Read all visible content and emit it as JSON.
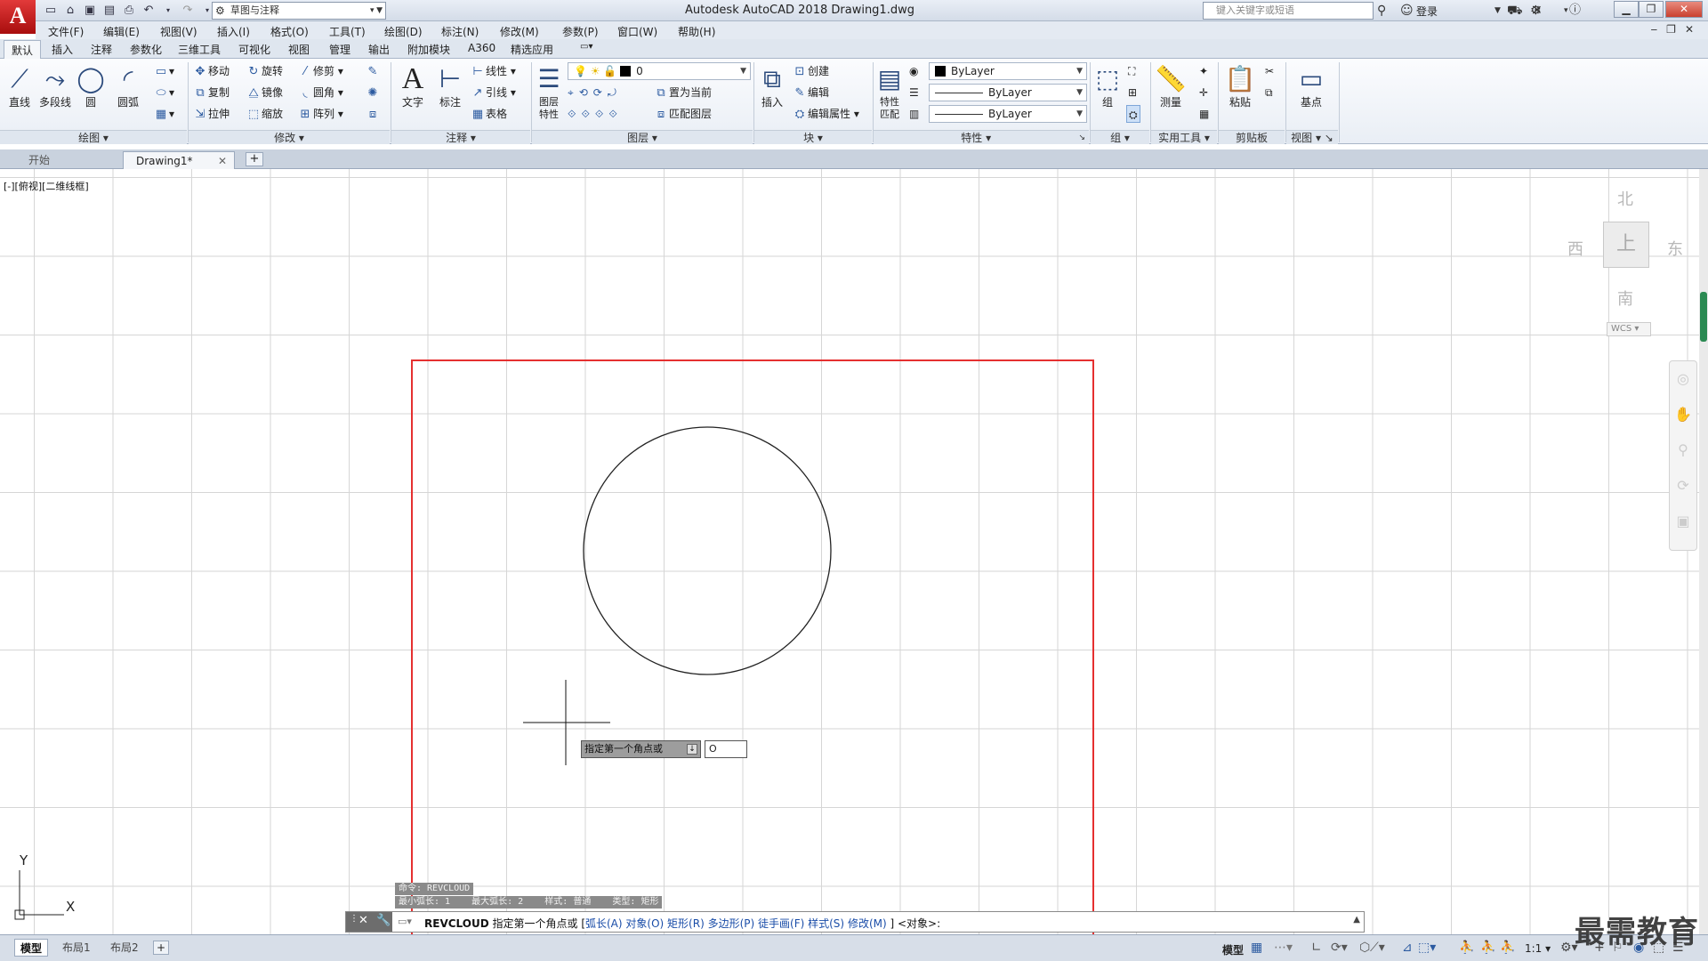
{
  "titlebar": {
    "logo": "A",
    "workspace": "草图与注释",
    "window_title": "Autodesk AutoCAD 2018    Drawing1.dwg",
    "search_placeholder": "键入关键字或短语",
    "login": "登录"
  },
  "menu": [
    "文件(F)",
    "编辑(E)",
    "视图(V)",
    "插入(I)",
    "格式(O)",
    "工具(T)",
    "绘图(D)",
    "标注(N)",
    "修改(M)",
    "参数(P)",
    "窗口(W)",
    "帮助(H)"
  ],
  "ribbon_tabs": [
    "默认",
    "插入",
    "注释",
    "参数化",
    "三维工具",
    "可视化",
    "视图",
    "管理",
    "输出",
    "附加模块",
    "A360",
    "精选应用"
  ],
  "ribbon": {
    "draw": {
      "title": "绘图",
      "line": "直线",
      "polyline": "多段线",
      "circle": "圆",
      "arc": "圆弧"
    },
    "modify": {
      "title": "修改",
      "move": "移动",
      "rotate": "旋转",
      "trim": "修剪",
      "copy": "复制",
      "mirror": "镜像",
      "fillet": "圆角",
      "stretch": "拉伸",
      "scale": "缩放",
      "array": "阵列"
    },
    "annotation": {
      "title": "注释",
      "text": "文字",
      "dimension": "标注",
      "linear": "线性",
      "leader": "引线",
      "table": "表格"
    },
    "layers": {
      "title": "图层",
      "properties": "图层\n特性",
      "current_layer": "0",
      "set_current": "置为当前",
      "match_layer": "匹配图层"
    },
    "block": {
      "title": "块",
      "insert": "插入",
      "create": "创建",
      "edit": "编辑",
      "edit_attr": "编辑属性"
    },
    "properties": {
      "title": "特性",
      "match": "特性\n匹配",
      "color": "ByLayer",
      "linetype": "ByLayer",
      "lineweight": "ByLayer"
    },
    "groups": {
      "title": "组",
      "group": "组"
    },
    "utilities": {
      "title": "实用工具",
      "measure": "测量"
    },
    "clipboard": {
      "title": "剪贴板",
      "paste": "粘贴"
    },
    "view": {
      "title": "视图",
      "base": "基点"
    }
  },
  "file_tabs": {
    "start": "开始",
    "drawing": "Drawing1*"
  },
  "viewport_label": "[-][俯视][二维线框]",
  "viewcube": {
    "north": "北",
    "south": "南",
    "east": "东",
    "west": "西",
    "face": "上",
    "wcs": "WCS"
  },
  "dynamic_input": {
    "prompt": "指定第一个角点或",
    "value": "O"
  },
  "ucs": {
    "x": "X",
    "y": "Y"
  },
  "command": {
    "history": [
      "命令: REVCLOUD",
      "最小弧长: 1    最大弧长: 2    样式: 普通    类型: 矩形"
    ],
    "name": "REVCLOUD",
    "prompt": "指定第一个角点或",
    "options": [
      "弧长(A)",
      "对象(O)",
      "矩形(R)",
      "多边形(P)",
      "徒手画(F)",
      "样式(S)",
      "修改(M)"
    ],
    "suffix": "] <对象>:"
  },
  "layout_tabs": [
    "模型",
    "布局1",
    "布局2"
  ],
  "status": {
    "model": "模型",
    "scale": "1:1"
  },
  "watermark": "最需教育"
}
